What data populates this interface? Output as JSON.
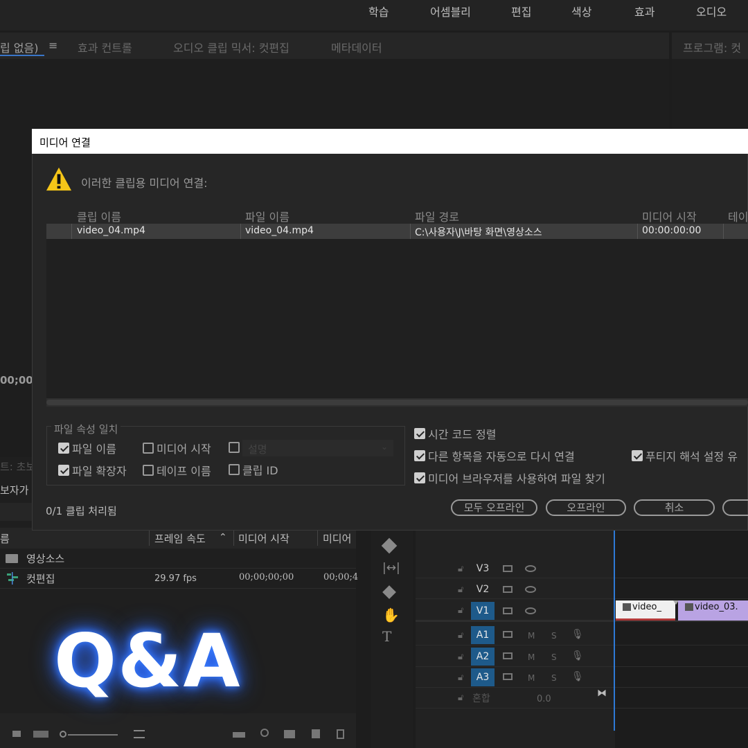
{
  "workspaces": [
    "학습",
    "어셈블리",
    "편집",
    "색상",
    "효과",
    "오디오"
  ],
  "source_panel": {
    "tabs": [
      "립 없음)",
      "효과 컨트롤",
      "오디오 클립 믹서: 컷편집",
      "메타데이터"
    ],
    "menu_icon": "≡",
    "timecode": "00;00"
  },
  "program_panel": {
    "tab": "프로그램: 컷"
  },
  "project_panel": {
    "partial_label_1": "트: 초보",
    "partial_label_2": "보자가",
    "columns": [
      "름",
      "프레임 속도",
      "미디어 시작",
      "미디어"
    ],
    "rows": [
      {
        "name": "영상소스",
        "icon": "folder-icon",
        "fps": "",
        "start": "",
        "end": ""
      },
      {
        "name": "컷편집",
        "icon": "sequence-icon",
        "fps": "29.97 fps",
        "start": "00;00;00;00",
        "end": "00;00;4"
      }
    ]
  },
  "timeline": {
    "tracks": [
      {
        "label": "V3",
        "active": false
      },
      {
        "label": "V2",
        "active": false
      },
      {
        "label": "V1",
        "active": true
      },
      {
        "label": "A1",
        "active": true
      },
      {
        "label": "A2",
        "active": true
      },
      {
        "label": "A3",
        "active": true
      }
    ],
    "mix_label": "혼합",
    "mix_value": "0.0",
    "clips": [
      {
        "label": "video_",
        "color": "#f0f0f0"
      },
      {
        "label": "video_03.",
        "color": "#b9a3e3"
      }
    ]
  },
  "overlay_text": "Q&A",
  "dialog": {
    "title": "미디어 연결",
    "message": "이러한 클립용 미디어 연결:",
    "columns": [
      "클립 이름",
      "파일 이름",
      "파일 경로",
      "미디어 시작",
      "테이"
    ],
    "row": {
      "clip": "video_04.mp4",
      "file": "video_04.mp4",
      "path": "C:\\사용자\\J\\바탕 화면\\영상소스",
      "start": "00:00:00:00"
    },
    "match_group": "파일 속성 일치",
    "options": {
      "file_name": "파일 이름",
      "media_start": "미디어 시작",
      "description": "설명",
      "file_ext": "파일 확장자",
      "tape_name": "테이프 이름",
      "clip_id": "클립 ID",
      "align_timecode": "시간 코드 정렬",
      "auto_relink": "다른 항목을 자동으로 다시 연결",
      "media_browser": "미디어 브라우저를 사용하여 파일 찾기",
      "preserve_footage": "푸티지 해석 설정 유"
    },
    "status": "0/1 클립 처리됨",
    "buttons": {
      "all_offline": "모두 오프라인",
      "offline": "오프라인",
      "cancel": "취소"
    }
  }
}
